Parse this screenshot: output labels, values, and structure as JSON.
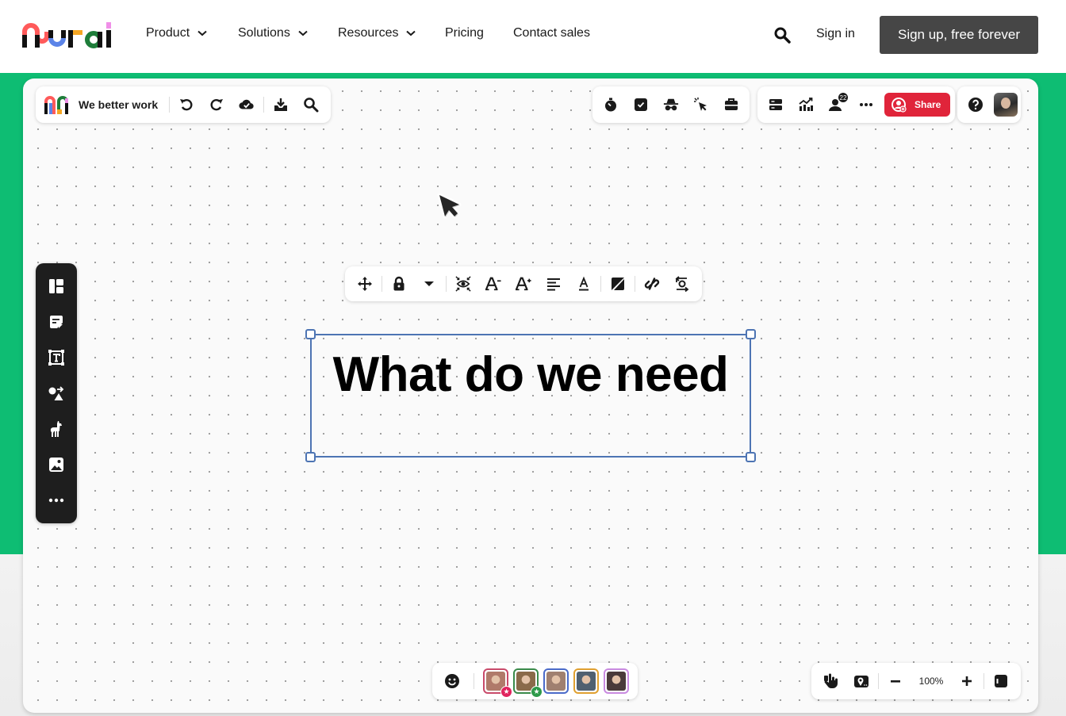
{
  "nav": {
    "brand": "Mural",
    "items": [
      {
        "label": "Product",
        "has_dropdown": true
      },
      {
        "label": "Solutions",
        "has_dropdown": true
      },
      {
        "label": "Resources",
        "has_dropdown": true
      },
      {
        "label": "Pricing",
        "has_dropdown": false
      },
      {
        "label": "Contact sales",
        "has_dropdown": false
      }
    ],
    "search_icon": "search-icon",
    "signin_label": "Sign in",
    "signup_label": "Sign up, free forever"
  },
  "colors": {
    "brand_green": "#0ebd73",
    "share_red": "#e0243a",
    "signup_bg": "#464646",
    "selection_blue": "#4d74b3"
  },
  "board": {
    "title": "We better work",
    "toolbar_left": [
      "undo-icon",
      "redo-icon",
      "cloud-saved-icon",
      "export-icon",
      "search-icon"
    ],
    "toolbar_tools": [
      "timer-icon",
      "voting-icon",
      "private-mode-icon",
      "cursor-highlight-icon",
      "toolbox-icon"
    ],
    "toolbar_collab": [
      "outline-icon",
      "activity-icon",
      "participants-icon",
      "more-icon"
    ],
    "participants_count": "22",
    "share_label": "Share",
    "help_icon": "help-icon"
  },
  "left_toolbar": [
    "templates-icon",
    "sticky-note-icon",
    "text-icon",
    "shapes-icon",
    "llama-icon",
    "image-icon",
    "more-icon"
  ],
  "text_toolbar": [
    "move-icon",
    "lock-icon",
    "dropdown-icon",
    "focus-icon",
    "decrease-font-icon",
    "increase-font-icon",
    "align-left-icon",
    "text-color-icon",
    "no-fill-icon",
    "link-icon",
    "swap-icon"
  ],
  "canvas": {
    "selected_text": "What do we need"
  },
  "bottom": {
    "reaction_icon": "emoji-icon",
    "collaborators": [
      {
        "name": "collaborator-1",
        "border": "#c94a6a",
        "face": "#b07a6a",
        "starred": true,
        "star_color": "#e0245e"
      },
      {
        "name": "collaborator-2",
        "border": "#3a8a4a",
        "face": "#8a6a4a",
        "starred": true,
        "star_color": "#2e9a4a"
      },
      {
        "name": "collaborator-3",
        "border": "#4a6ac9",
        "face": "#a08070",
        "starred": false
      },
      {
        "name": "collaborator-4",
        "border": "#e0a030",
        "face": "#506070",
        "starred": false
      },
      {
        "name": "collaborator-5",
        "border": "#c98ae0",
        "face": "#4a3a3a",
        "starred": false
      }
    ],
    "zoom_level": "100%"
  }
}
